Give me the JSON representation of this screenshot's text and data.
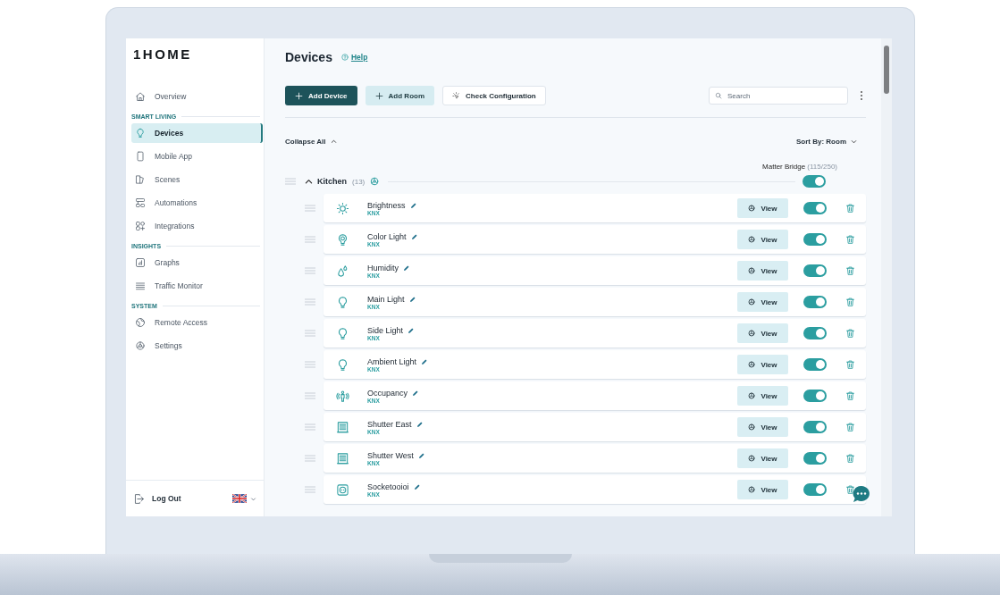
{
  "logo": "1HOME",
  "sidebar": {
    "items": [
      {
        "kind": "item",
        "label": "Overview",
        "selected": false
      },
      {
        "kind": "section",
        "label": "SMART LIVING"
      },
      {
        "kind": "item",
        "label": "Devices",
        "selected": true
      },
      {
        "kind": "item",
        "label": "Mobile App",
        "selected": false
      },
      {
        "kind": "item",
        "label": "Scenes",
        "selected": false
      },
      {
        "kind": "item",
        "label": "Automations",
        "selected": false
      },
      {
        "kind": "item",
        "label": "Integrations",
        "selected": false
      },
      {
        "kind": "section",
        "label": "INSIGHTS"
      },
      {
        "kind": "item",
        "label": "Graphs",
        "selected": false
      },
      {
        "kind": "item",
        "label": "Traffic Monitor",
        "selected": false
      },
      {
        "kind": "section",
        "label": "SYSTEM"
      },
      {
        "kind": "item",
        "label": "Remote Access",
        "selected": false
      },
      {
        "kind": "item",
        "label": "Settings",
        "selected": false
      }
    ],
    "logout": "Log Out"
  },
  "header": {
    "title": "Devices",
    "help": "Help"
  },
  "toolbar": {
    "buttons": [
      {
        "kind": "primary",
        "label": "Add Device"
      },
      {
        "kind": "secondary",
        "label": "Add Room"
      },
      {
        "kind": "outline",
        "label": "Check Configuration"
      }
    ],
    "search": {
      "placeholder": "Search"
    }
  },
  "collapse_all": "Collapse All",
  "sort": "Sort By: Room",
  "matter_bridge": {
    "label": "Matter Bridge",
    "count": "(115/250)"
  },
  "room": {
    "name": "Kitchen",
    "count": "(13)",
    "expanded": true,
    "bridge_on": true,
    "devices": [
      {
        "kind": "brightness",
        "name": "Brightness",
        "protocol": "KNX",
        "action": "View",
        "on": true
      },
      {
        "kind": "color-light",
        "name": "Color Light",
        "protocol": "KNX",
        "action": "View",
        "on": true
      },
      {
        "kind": "humidity",
        "name": "Humidity",
        "protocol": "KNX",
        "action": "View",
        "on": true
      },
      {
        "kind": "light",
        "name": "Main Light",
        "protocol": "KNX",
        "action": "View",
        "on": true
      },
      {
        "kind": "light",
        "name": "Side Light",
        "protocol": "KNX",
        "action": "View",
        "on": true
      },
      {
        "kind": "light",
        "name": "Ambient Light",
        "protocol": "KNX",
        "action": "View",
        "on": true
      },
      {
        "kind": "occupancy",
        "name": "Occupancy",
        "protocol": "KNX",
        "action": "View",
        "on": true
      },
      {
        "kind": "shutter",
        "name": "Shutter East",
        "protocol": "KNX",
        "action": "View",
        "on": true
      },
      {
        "kind": "shutter",
        "name": "Shutter West",
        "protocol": "KNX",
        "action": "View",
        "on": true
      },
      {
        "kind": "socket",
        "name": "Socketooioi",
        "protocol": "KNX",
        "action": "View",
        "on": true
      }
    ]
  }
}
